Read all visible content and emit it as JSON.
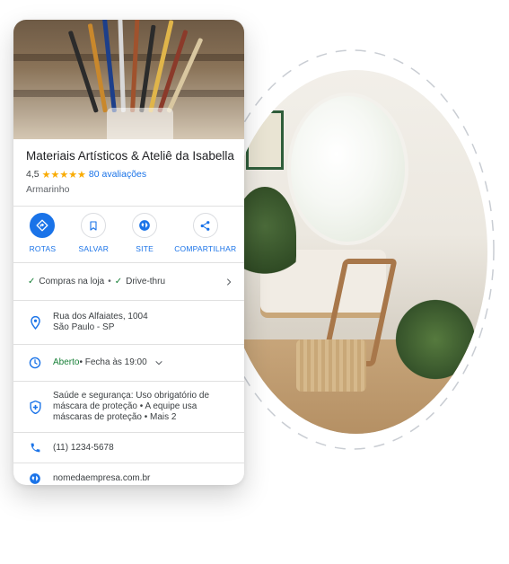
{
  "place": {
    "name": "Materiais Artísticos & Ateliê da Isabella",
    "rating": "4,5",
    "stars": "★★★★★",
    "reviews": "80 avaliações",
    "category": "Armarinho"
  },
  "actions": [
    {
      "label": "ROTAS",
      "icon": "directions-icon"
    },
    {
      "label": "SALVAR",
      "icon": "bookmark-icon"
    },
    {
      "label": "SITE",
      "icon": "globe-icon"
    },
    {
      "label": "COMPARTILHAR",
      "icon": "share-icon"
    }
  ],
  "services": {
    "item1": "Compras na loja",
    "item2": "Drive-thru",
    "separator": "•",
    "check": "✓"
  },
  "address": {
    "line1": "Rua dos Alfaiates, 1004",
    "line2": "São Paulo - SP"
  },
  "hours": {
    "status": "Aberto",
    "detail": " • Fecha às 19:00"
  },
  "safety": {
    "text": "Saúde e segurança: Uso obrigatório de máscara de proteção • A equipe usa máscaras de proteção • Mais 2"
  },
  "phone": "(11) 1234-5678",
  "website": "nomedaempresa.com.br",
  "colors": {
    "accent": "#1a73e8",
    "open": "#188038",
    "star": "#f9ab00"
  }
}
